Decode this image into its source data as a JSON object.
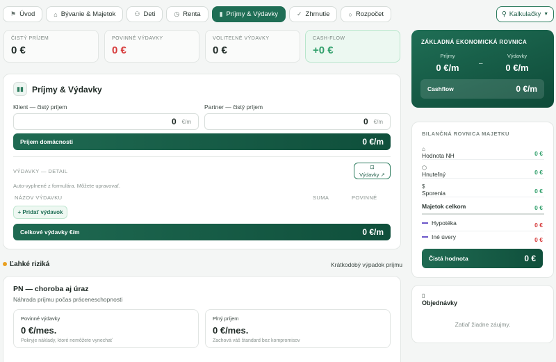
{
  "nav": {
    "tabs": [
      {
        "label": "Úvod",
        "icon": "flag-icon"
      },
      {
        "label": "Bývanie & Majetok",
        "icon": "home-icon"
      },
      {
        "label": "Deti",
        "icon": "family-icon"
      },
      {
        "label": "Renta",
        "icon": "clock-icon"
      },
      {
        "label": "Príjmy & Výdavky",
        "icon": "bar-chart-icon",
        "active": true
      },
      {
        "label": "Zhrnutie",
        "icon": "check-icon"
      },
      {
        "label": "Rozpočet",
        "icon": "budget-icon"
      }
    ],
    "calculators_label": "Kalkulačky"
  },
  "summary": {
    "net_income": {
      "label": "ČISTÝ PRÍJEM",
      "value": "0 €"
    },
    "mandatory": {
      "label": "POVINNÉ VÝDAVKY",
      "value": "0 €"
    },
    "optional": {
      "label": "VOLITEĽNÉ VÝDAVKY",
      "value": "0 €"
    },
    "cashflow": {
      "label": "CASH-FLOW",
      "value": "+0 €"
    }
  },
  "income_card": {
    "title": "Príjmy & Výdavky",
    "client_label": "Klient — čistý príjem",
    "client_value": "0",
    "partner_label": "Partner — čistý príjem",
    "partner_value": "0",
    "unit": "€/m",
    "household_label": "Príjem domácnosti",
    "household_value": "0 €/m",
    "expenses_detail_label": "VÝDAVKY — DETAIL",
    "expenses_button": "Výdavky ↗",
    "autofill_note": "Auto-vyplnené z formulára. Môžete upravovať.",
    "col_name": "NÁZOV VÝDAVKU",
    "col_sum": "SUMA",
    "col_mandatory": "POVINNÉ",
    "add_button": "+ Pridať výdavok",
    "total_label": "Celkové výdavky €/m",
    "total_value": "0 €/m"
  },
  "risks": {
    "title": "Ľahké riziká",
    "right_label": "Krátkodobý výpadok príjmu",
    "pn_title": "PN — choroba aj úraz",
    "pn_subtitle": "Náhrada príjmu počas práceneschopnosti",
    "mandatory_box": {
      "label": "Povinné výdavky",
      "value": "0 €/mes.",
      "note": "Pokryje náklady, ktoré nemôžete vynechať"
    },
    "full_box": {
      "label": "Plný príjem",
      "value": "0 €/mes.",
      "note": "Zachová váš štandard bez kompromisov"
    }
  },
  "equation": {
    "title": "Základná ekonomická rovnica",
    "income_label": "Príjmy",
    "income_value": "0 €/m",
    "expenses_label": "Výdavky",
    "expenses_value": "0 €/m",
    "dash": "–",
    "cashflow_label": "Cashflow",
    "cashflow_value": "0 €/m"
  },
  "balance": {
    "title": "BILANČNÁ ROVNICA MAJETKU",
    "rows": [
      {
        "label": "Hodnota NH",
        "value": "0 €"
      },
      {
        "label": "Hnuteľný",
        "value": "0 €"
      },
      {
        "label": "Sporenia",
        "value": "0 €"
      },
      {
        "label": "Majetok celkom",
        "value": "0 €"
      },
      {
        "label": "Hypotéka",
        "value": "0 €"
      },
      {
        "label": "Iné úvery",
        "value": "0 €"
      }
    ],
    "net_label": "Čistá hodnota",
    "net_value": "0 €"
  },
  "orders": {
    "title": "Objednávky",
    "empty": "Zatiaľ žiadne záujmy."
  },
  "colors": {
    "accent": "#1f6e55",
    "negative": "#d63a3a",
    "positive": "#2f9f6a",
    "warning": "#e9a021",
    "liability": "#6b56c8"
  }
}
